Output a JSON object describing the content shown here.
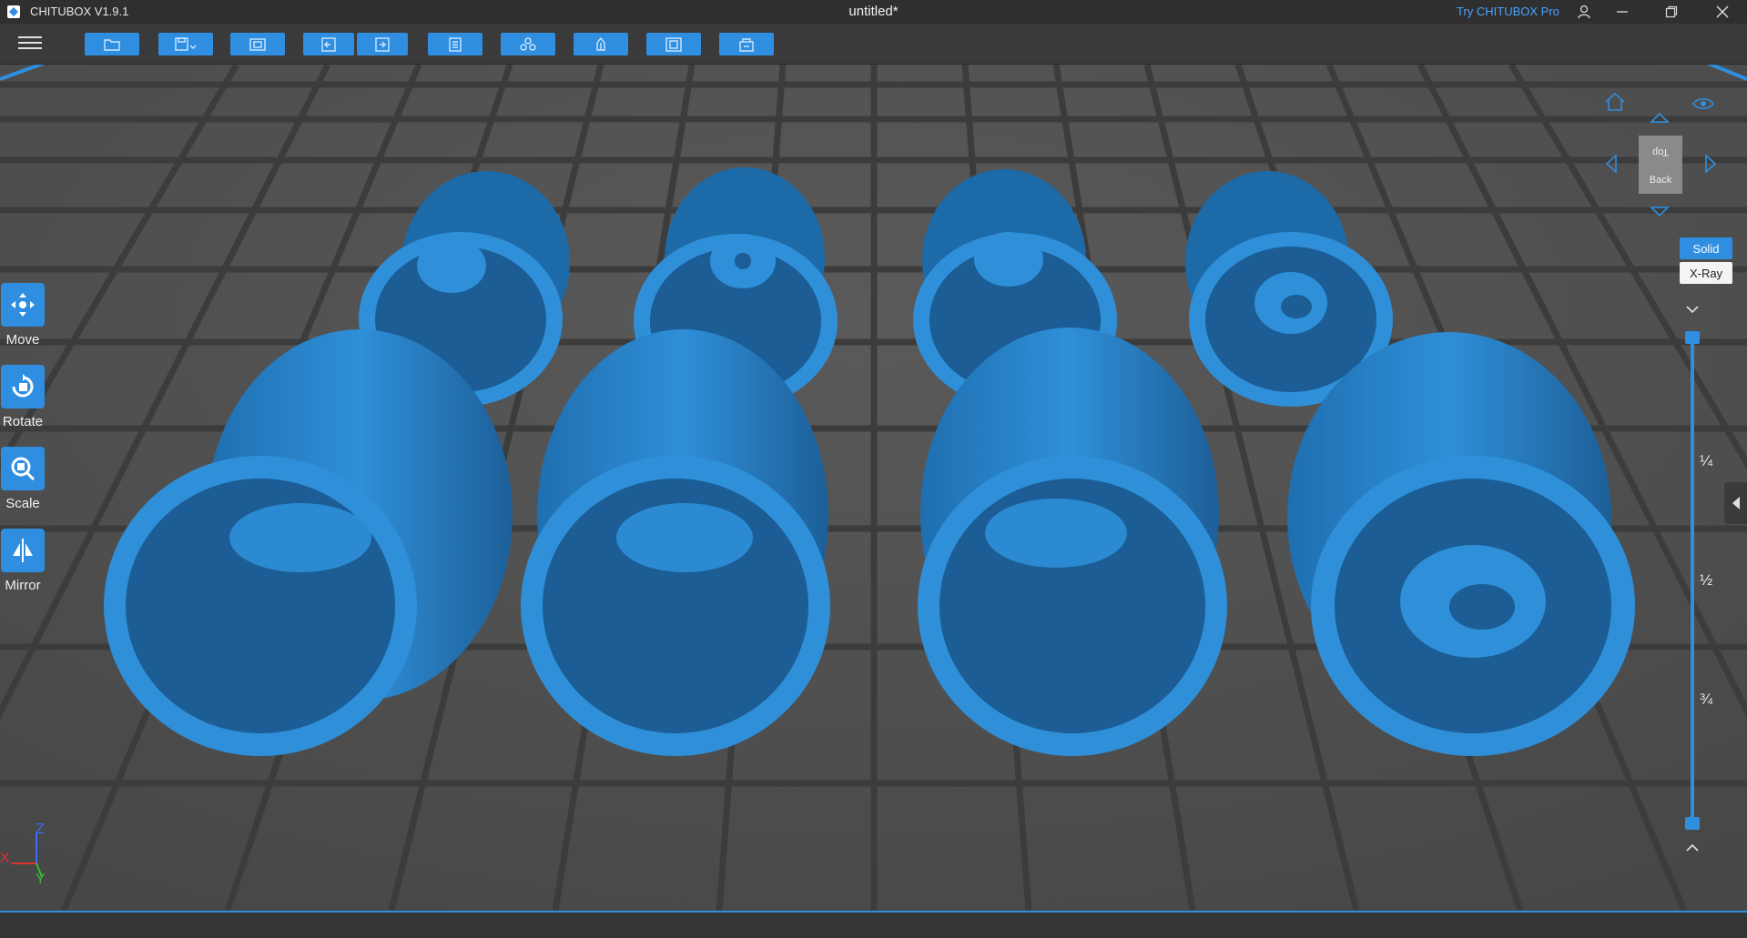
{
  "app": {
    "name": "CHITUBOX V1.9.1",
    "document_title": "untitled*",
    "try_pro_label": "Try CHITUBOX Pro"
  },
  "toolbar": {
    "buttons": [
      "open-file-icon",
      "save-icon",
      "screenshot-icon",
      "undo-icon",
      "redo-icon",
      "settings-icon",
      "layout-icon",
      "support-icon",
      "hollow-icon",
      "slice-icon"
    ]
  },
  "left_tools": [
    {
      "label": "Move",
      "icon": "move-icon"
    },
    {
      "label": "Rotate",
      "icon": "rotate-icon"
    },
    {
      "label": "Scale",
      "icon": "scale-icon"
    },
    {
      "label": "Mirror",
      "icon": "mirror-icon"
    }
  ],
  "view_cube": {
    "top_face": "Top",
    "back_face": "Back"
  },
  "render_modes": {
    "solid": "Solid",
    "xray": "X-Ray"
  },
  "layer_slider": {
    "marks": [
      "¼",
      "½",
      "¾"
    ],
    "top_value": 1.0,
    "bottom_value": 0.0
  },
  "axes": {
    "x": "X",
    "y": "Y",
    "z": "Z"
  },
  "colors": {
    "accent": "#2f8ee0",
    "model": "#2f8fd8",
    "background": "#4a4a4a"
  }
}
